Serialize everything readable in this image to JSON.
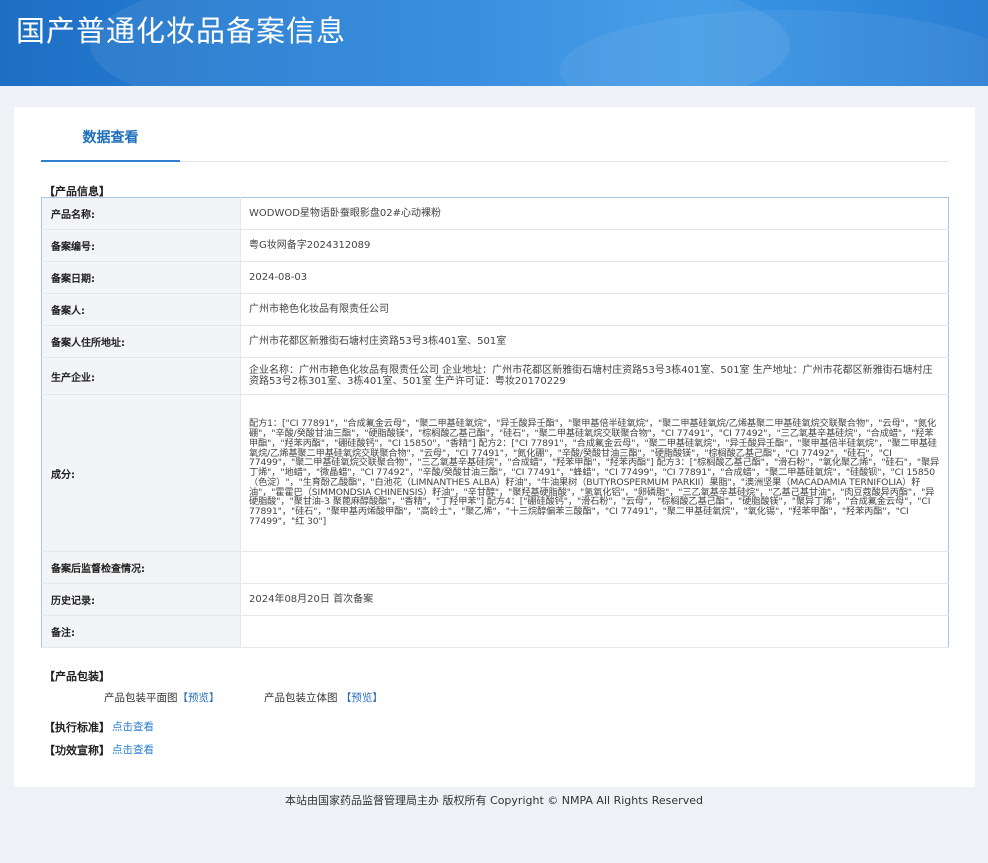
{
  "header": {
    "title": "国产普通化妆品备案信息"
  },
  "tabs": {
    "active": "数据查看"
  },
  "sections": {
    "product_info": "【产品信息】",
    "packaging": "【产品包装】",
    "standard": "【执行标准】",
    "claims": "【功效宣称】"
  },
  "rows": [
    {
      "key": "产品名称:",
      "value": "WODWOD星物语卧蚕眼影盘02#心动裸粉"
    },
    {
      "key": "备案编号:",
      "value": "粤G妆网备字2024312089"
    },
    {
      "key": "备案日期:",
      "value": "2024-08-03"
    },
    {
      "key": "备案人:",
      "value": "广州市艳色化妆品有限责任公司"
    },
    {
      "key": "备案人住所地址:",
      "value": "广州市花都区新雅街石塘村庄资路53号3栋401室、501室"
    },
    {
      "key": "生产企业:",
      "value": "企业名称：广州市艳色化妆品有限责任公司 企业地址：广州市花都区新雅街石塘村庄资路53号3栋401室、501室 生产地址：广州市花都区新雅街石塘村庄资路53号2栋301室、3栋401室、501室 生产许可证：粤妆20170229"
    },
    {
      "key": "成分:",
      "value": "配方1：[\"CI 77891\"，\"合成氟金云母\"，\"聚二甲基硅氧烷\"，\"异壬酸异壬酯\"，\"聚甲基倍半硅氧烷\"，\"聚二甲基硅氧烷/乙烯基聚二甲基硅氧烷交联聚合物\"，\"云母\"，\"氮化硼\"，\"辛酸/癸酸甘油三酯\"，\"硬脂酸镁\"，\"棕榈酸乙基己酯\"，\"硅石\"，\"聚二甲基硅氧烷交联聚合物\"，\"CI 77491\"，\"CI 77492\"，\"三乙氧基辛基硅烷\"，\"合成蜡\"，\"羟苯甲酯\"，\"羟苯丙酯\"，\"硼硅酸钙\"，\"CI 15850\"，\"香精\"] 配方2：[\"CI 77891\"，\"合成氟金云母\"，\"聚二甲基硅氧烷\"，\"异壬酸异壬酯\"，\"聚甲基倍半硅氧烷\"，\"聚二甲基硅氧烷/乙烯基聚二甲基硅氧烷交联聚合物\"，\"云母\"，\"CI 77491\"，\"氮化硼\"，\"辛酸/癸酸甘油三酯\"，\"硬脂酸镁\"，\"棕榈酸乙基己酯\"，\"CI 77492\"，\"硅石\"，\"CI 77499\"，\"聚二甲基硅氧烷交联聚合物\"，\"三乙氧基辛基硅烷\"，\"合成蜡\"，\"羟苯甲酯\"，\"羟苯丙酯\"] 配方3：[\"棕榈酸乙基己酯\"，\"滑石粉\"，\"氧化聚乙烯\"，\"硅石\"，\"聚异丁烯\"，\"地蜡\"，\"微晶蜡\"，\"CI 77492\"，\"辛酸/癸酸甘油三酯\"，\"CI 77491\"，\"蜂蜡\"，\"CI 77499\"，\"CI 77891\"，\"合成蜡\"，\"聚二甲基硅氧烷\"，\"硅酸钡\"，\"CI 15850（色淀）\"，\"生育酚乙酸酯\"，\"白池花（LIMNANTHES ALBA）籽油\"，\"牛油果树（BUTYROSPERMUM PARKII）果脂\"，\"澳洲坚果（MACADAMIA TERNIFOLIA）籽油\"，\"霍霍巴（SIMMONDSIA CHINENSIS）籽油\"，\"辛甘醇\"，\"聚羟基硬脂酸\"，\"氢氧化铝\"，\"卵磷脂\"，\"三乙氧基辛基硅烷\"，\"乙基己基甘油\"，\"肉豆蔻酸异丙酯\"，\"异硬脂酸\"，\"聚甘油-3 聚蓖麻醇酸酯\"，\"香精\"，\"丁羟甲苯\"] 配方4：[\"硼硅酸钙\"，\"滑石粉\"，\"云母\"，\"棕榈酸乙基己酯\"，\"硬脂酸镁\"，\"聚异丁烯\"，\"合成氟金云母\"，\"CI 77891\"，\"硅石\"，\"聚甲基丙烯酸甲酯\"，\"高岭土\"，\"聚乙烯\"，\"十三烷醇偏苯三酸酯\"，\"CI 77491\"，\"聚二甲基硅氧烷\"，\"氧化锡\"，\"羟苯甲酯\"，\"羟苯丙酯\"，\"CI 77499\"，\"红 30\"]"
    },
    {
      "key": "备案后监督检查情况:",
      "value": ""
    },
    {
      "key": "历史记录:",
      "value": "2024年08月20日 首次备案"
    },
    {
      "key": "备注:",
      "value": ""
    }
  ],
  "packaging": {
    "flat_label": "产品包装平面图",
    "flat_link": "【预览】",
    "3d_label": "产品包装立体图",
    "3d_link": "【预览】"
  },
  "links": {
    "standard": "点击查看",
    "claims": "点击查看"
  },
  "footer": {
    "text": "本站由国家药品监督管理局主办 版权所有 Copyright © NMPA All Rights Reserved"
  }
}
